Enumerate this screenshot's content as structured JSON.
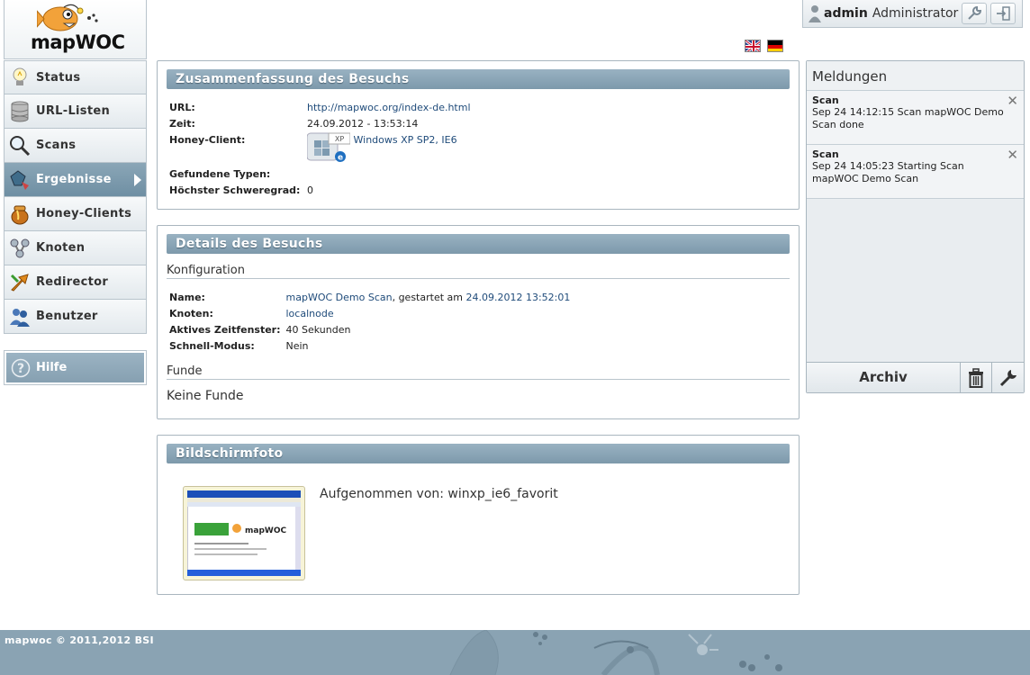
{
  "app": {
    "name": "mapWOC"
  },
  "nav": {
    "items": [
      {
        "label": "Status",
        "icon": "lightbulb-icon"
      },
      {
        "label": "URL-Listen",
        "icon": "database-icon"
      },
      {
        "label": "Scans",
        "icon": "magnifier-icon"
      },
      {
        "label": "Ergebnisse",
        "icon": "results-icon",
        "active": true
      },
      {
        "label": "Honey-Clients",
        "icon": "honeypot-icon"
      },
      {
        "label": "Knoten",
        "icon": "nodes-icon"
      },
      {
        "label": "Redirector",
        "icon": "redirect-arrows-icon"
      },
      {
        "label": "Benutzer",
        "icon": "users-icon"
      }
    ],
    "help_label": "Hilfe"
  },
  "user": {
    "name": "admin",
    "role": "Administrator"
  },
  "summary": {
    "title": "Zusammenfassung des Besuchs",
    "url_label": "URL:",
    "url": "http://mapwoc.org/index-de.html",
    "time_label": "Zeit:",
    "time": "24.09.2012 - 13:53:14",
    "client_label": "Honey-Client:",
    "client": "Windows XP SP2, IE6",
    "client_badge": "XP",
    "types_label": "Gefundene Typen:",
    "types": "",
    "severity_label": "Höchster Schweregrad:",
    "severity": "0"
  },
  "details": {
    "title": "Details des Besuchs",
    "config_heading": "Konfiguration",
    "name_label": "Name:",
    "scan_name": "mapWOC Demo Scan",
    "started_text": ", gestartet am ",
    "started_at": "24.09.2012 13:52:01",
    "node_label": "Knoten:",
    "node": "localnode",
    "window_label": "Aktives Zeitfenster:",
    "window": "40 Sekunden",
    "fast_label": "Schnell-Modus:",
    "fast": "Nein",
    "findings_heading": "Funde",
    "findings": "Keine Funde"
  },
  "screenshot": {
    "title": "Bildschirmfoto",
    "caption": "Aufgenommen von: winxp_ie6_favorit",
    "thumb_logo": "mapWOC"
  },
  "messages": {
    "title": "Meldungen",
    "items": [
      {
        "title": "Scan",
        "text": "Sep 24 14:12:15 Scan mapWOC Demo Scan done"
      },
      {
        "title": "Scan",
        "text": "Sep 24 14:05:23 Starting Scan mapWOC Demo Scan"
      }
    ],
    "archive_label": "Archiv"
  },
  "footer": {
    "text": "mapwoc © 2011,2012 BSI"
  },
  "colors": {
    "accent": "#7d99ab",
    "link": "#1f4b7a",
    "footer": "#8aa3b3"
  }
}
